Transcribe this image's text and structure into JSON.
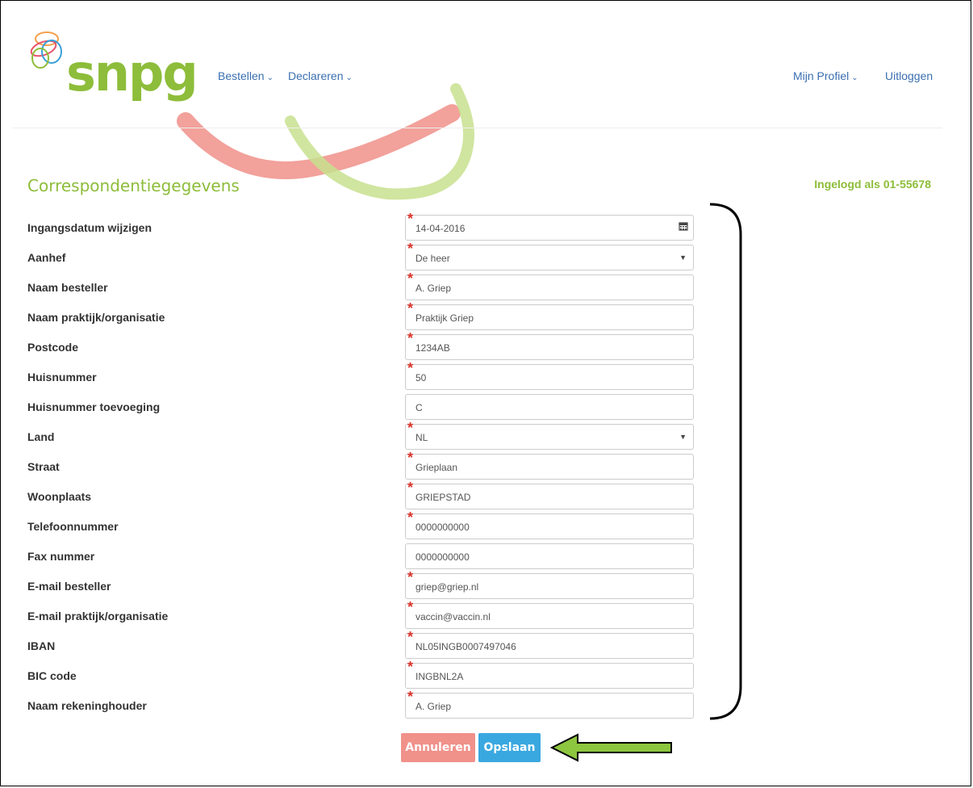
{
  "header": {
    "logo_text": "snpg",
    "nav_left": [
      {
        "label": "Bestellen"
      },
      {
        "label": "Declareren"
      }
    ],
    "nav_right": [
      {
        "label": "Mijn Profiel"
      },
      {
        "label": "Uitloggen"
      }
    ]
  },
  "page": {
    "title": "Correspondentiegegevens",
    "logged_in": "Ingelogd als 01-55678"
  },
  "form": {
    "fields": [
      {
        "label": "Ingangsdatum wijzigen",
        "value": "14-04-2016",
        "required": true,
        "type": "date"
      },
      {
        "label": "Aanhef",
        "value": "De heer",
        "required": true,
        "type": "select"
      },
      {
        "label": "Naam besteller",
        "value": "A. Griep",
        "required": true,
        "type": "text"
      },
      {
        "label": "Naam praktijk/organisatie",
        "value": "Praktijk Griep",
        "required": true,
        "type": "text"
      },
      {
        "label": "Postcode",
        "value": "1234AB",
        "required": true,
        "type": "text"
      },
      {
        "label": "Huisnummer",
        "value": "50",
        "required": true,
        "type": "text"
      },
      {
        "label": "Huisnummer toevoeging",
        "value": "C",
        "required": false,
        "type": "text"
      },
      {
        "label": "Land",
        "value": "NL",
        "required": true,
        "type": "select"
      },
      {
        "label": "Straat",
        "value": "Grieplaan",
        "required": true,
        "type": "text"
      },
      {
        "label": "Woonplaats",
        "value": "GRIEPSTAD",
        "required": true,
        "type": "text"
      },
      {
        "label": "Telefoonnummer",
        "value": "0000000000",
        "required": true,
        "type": "text"
      },
      {
        "label": "Fax nummer",
        "value": "0000000000",
        "required": false,
        "type": "text"
      },
      {
        "label": "E-mail besteller",
        "value": "griep@griep.nl",
        "required": true,
        "type": "text"
      },
      {
        "label": "E-mail praktijk/organisatie",
        "value": "vaccin@vaccin.nl",
        "required": true,
        "type": "text"
      },
      {
        "label": "IBAN",
        "value": "NL05INGB0007497046",
        "required": true,
        "type": "text"
      },
      {
        "label": "BIC code",
        "value": "INGBNL2A",
        "required": true,
        "type": "text"
      },
      {
        "label": "Naam rekeninghouder",
        "value": "A. Griep",
        "required": true,
        "type": "text"
      }
    ],
    "required_mark": "*",
    "cancel_label": "Annuleren",
    "save_label": "Opslaan"
  },
  "colors": {
    "brand_green": "#8dbd3a",
    "link_blue": "#3a6fb0",
    "required_red": "#d9342b",
    "cancel_button": "#f0918a",
    "save_button": "#3aa8e0",
    "arrow_green": "#8dc63f"
  },
  "icons": {
    "date_field": "calendar-icon",
    "select_field": "caret-down-icon",
    "nav_dropdown": "chevron-down-icon"
  }
}
